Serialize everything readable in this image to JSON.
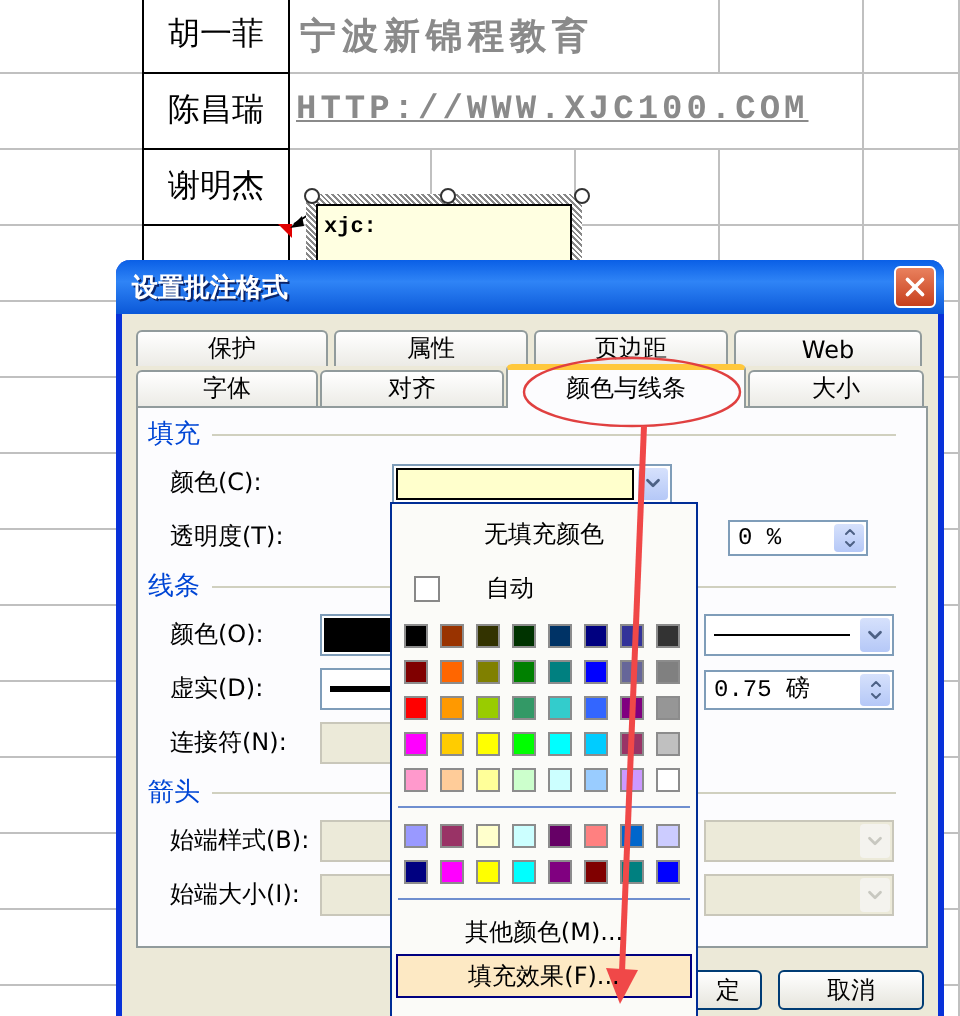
{
  "sheet": {
    "rows": [
      {
        "name": "胡一菲",
        "note": "宁波新锦程教育",
        "kind": "banner"
      },
      {
        "name": "陈昌瑞",
        "note": "HTTP://WWW.XJC100.COM",
        "kind": "link"
      },
      {
        "name": "谢明杰"
      }
    ]
  },
  "comment": {
    "text": "xjc:"
  },
  "dialog": {
    "title": "设置批注格式",
    "tab_rows": [
      [
        {
          "label": "保护",
          "selected": false
        },
        {
          "label": "属性",
          "selected": false
        },
        {
          "label": "页边距",
          "selected": false
        },
        {
          "label": "Web",
          "selected": false
        }
      ],
      [
        {
          "label": "字体",
          "selected": false
        },
        {
          "label": "对齐",
          "selected": false
        },
        {
          "label": "颜色与线条",
          "selected": true
        },
        {
          "label": "大小",
          "selected": false
        }
      ]
    ],
    "sections": [
      {
        "title": "填充",
        "rows": [
          {
            "label": "颜色(C):",
            "left": {
              "kind": "fill-combo",
              "color": "#ffffcc"
            }
          },
          {
            "label": "透明度(T):",
            "right": {
              "kind": "percent-spin",
              "value": "0 %"
            }
          }
        ]
      },
      {
        "title": "线条",
        "rows": [
          {
            "label": "颜色(O):",
            "left": {
              "kind": "color-combo",
              "color": "#000000"
            },
            "right": {
              "kind": "line-combo"
            }
          },
          {
            "label": "虚实(D):",
            "left": {
              "kind": "line-combo"
            },
            "right": {
              "kind": "spin",
              "value": "0.75 磅"
            }
          },
          {
            "label": "连接符(N):",
            "left": {
              "kind": "disabled-combo"
            }
          }
        ]
      },
      {
        "title": "箭头",
        "rows": [
          {
            "label": "始端样式(B):",
            "left": {
              "kind": "disabled-combo"
            },
            "right": {
              "kind": "disabled-combo"
            }
          },
          {
            "label": "始端大小(I):",
            "left": {
              "kind": "disabled-combo"
            },
            "right": {
              "kind": "disabled-combo"
            }
          }
        ]
      }
    ],
    "buttons": [
      {
        "label": "定",
        "kind": "ok"
      },
      {
        "label": "取消",
        "kind": "cancel"
      }
    ]
  },
  "palette": {
    "none_label": "无填充颜色",
    "auto": {
      "label": "自动",
      "color": "#ffffff"
    },
    "standard": [
      {
        "color": "#000000"
      },
      {
        "color": "#993300"
      },
      {
        "color": "#333300"
      },
      {
        "color": "#003300"
      },
      {
        "color": "#003366"
      },
      {
        "color": "#000080"
      },
      {
        "color": "#333399"
      },
      {
        "color": "#333333"
      },
      {
        "color": "#800000"
      },
      {
        "color": "#ff6600"
      },
      {
        "color": "#808000"
      },
      {
        "color": "#008000"
      },
      {
        "color": "#008080"
      },
      {
        "color": "#0000ff"
      },
      {
        "color": "#666699"
      },
      {
        "color": "#808080"
      },
      {
        "color": "#ff0000"
      },
      {
        "color": "#ff9900"
      },
      {
        "color": "#99cc00"
      },
      {
        "color": "#339966"
      },
      {
        "color": "#33cccc"
      },
      {
        "color": "#3366ff"
      },
      {
        "color": "#800080"
      },
      {
        "color": "#969696"
      },
      {
        "color": "#ff00ff"
      },
      {
        "color": "#ffcc00"
      },
      {
        "color": "#ffff00"
      },
      {
        "color": "#00ff00"
      },
      {
        "color": "#00ffff"
      },
      {
        "color": "#00ccff"
      },
      {
        "color": "#993366"
      },
      {
        "color": "#c0c0c0"
      },
      {
        "color": "#ff99cc"
      },
      {
        "color": "#ffcc99"
      },
      {
        "color": "#ffff99"
      },
      {
        "color": "#ccffcc"
      },
      {
        "color": "#ccffff"
      },
      {
        "color": "#99ccff"
      },
      {
        "color": "#cc99ff"
      },
      {
        "color": "#ffffff"
      }
    ],
    "extra": [
      {
        "color": "#9999ff"
      },
      {
        "color": "#993366"
      },
      {
        "color": "#ffffcc"
      },
      {
        "color": "#ccffff"
      },
      {
        "color": "#660066"
      },
      {
        "color": "#ff8080"
      },
      {
        "color": "#0066cc"
      },
      {
        "color": "#ccccff"
      },
      {
        "color": "#000080"
      },
      {
        "color": "#ff00ff"
      },
      {
        "color": "#ffff00"
      },
      {
        "color": "#00ffff"
      },
      {
        "color": "#800080"
      },
      {
        "color": "#800000"
      },
      {
        "color": "#008080"
      },
      {
        "color": "#0000ff"
      }
    ],
    "menu_items": [
      {
        "label": "其他颜色(M)...",
        "selected": false
      },
      {
        "label": "填充效果(F)...",
        "selected": true
      }
    ]
  }
}
